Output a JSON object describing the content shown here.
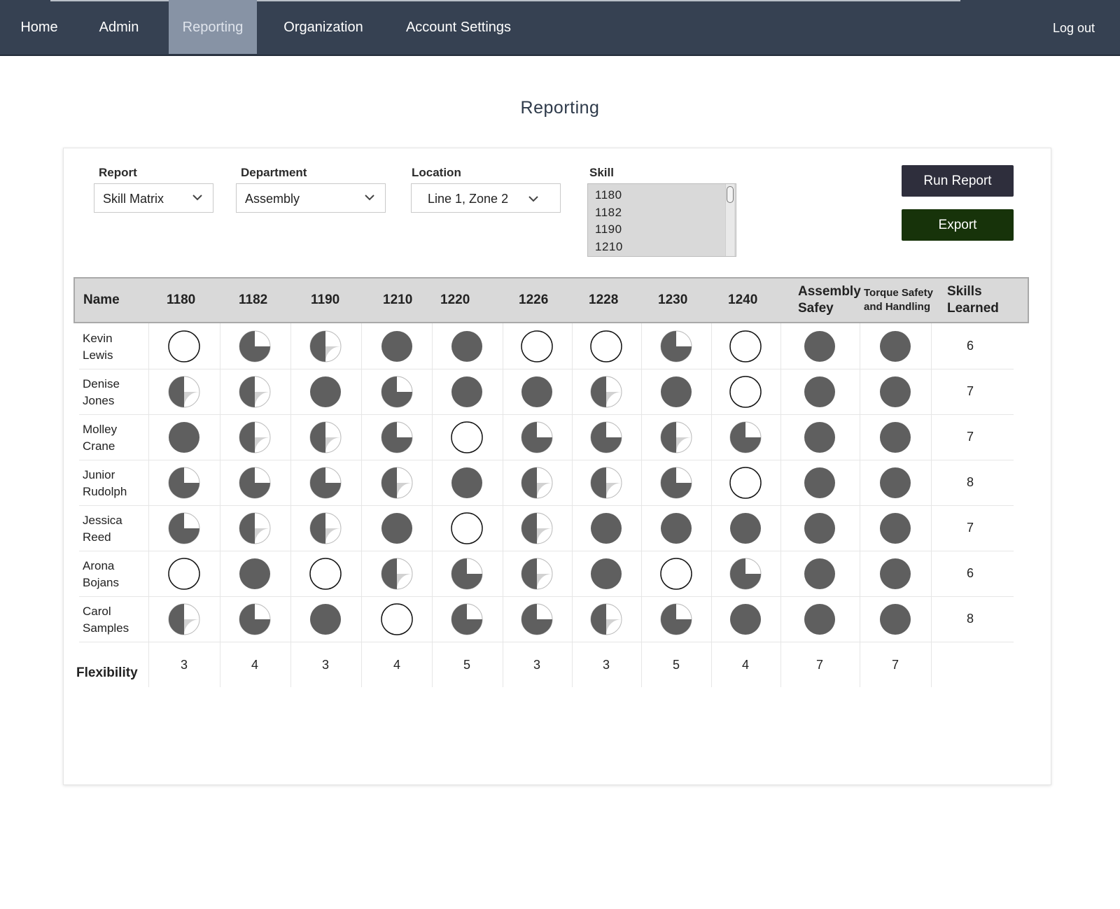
{
  "nav": {
    "items": [
      {
        "id": "home",
        "label": "Home"
      },
      {
        "id": "admin",
        "label": "Admin"
      },
      {
        "id": "reporting",
        "label": "Reporting"
      },
      {
        "id": "organization",
        "label": "Organization"
      },
      {
        "id": "account-settings",
        "label": "Account Settings"
      }
    ],
    "active": "Reporting",
    "logout": "Log out"
  },
  "page": {
    "title": "Reporting"
  },
  "filters": {
    "report": {
      "label": "Report",
      "value": "Skill Matrix"
    },
    "department": {
      "label": "Department",
      "value": "Assembly"
    },
    "location": {
      "label": "Location",
      "value": "Line 1, Zone 2"
    },
    "skill": {
      "label": "Skill",
      "options": [
        "1180",
        "1182",
        "1190",
        "1210"
      ]
    }
  },
  "buttons": {
    "run_report": "Run Report",
    "export": "Export"
  },
  "table": {
    "name_header": "Name",
    "skill_headers": [
      "1180",
      "1182",
      "1190",
      "1210",
      "1220",
      "1226",
      "1228",
      "1230",
      "1240",
      "Assembly Safey",
      "Torque Safety and Handling"
    ],
    "skills_learned_header": "Skills Learned",
    "rows": [
      {
        "name": "Kevin Lewis",
        "levels": [
          0,
          3,
          2,
          4,
          4,
          0,
          0,
          3,
          0,
          4,
          4
        ],
        "skills_learned": "6"
      },
      {
        "name": "Denise Jones",
        "levels": [
          2,
          2,
          4,
          3,
          4,
          4,
          2,
          4,
          0,
          4,
          4
        ],
        "skills_learned": "7"
      },
      {
        "name": "Molley Crane",
        "levels": [
          4,
          2,
          2,
          3,
          0,
          3,
          3,
          2,
          3,
          4,
          4
        ],
        "skills_learned": "7"
      },
      {
        "name": "Junior Rudolph",
        "levels": [
          3,
          3,
          3,
          2,
          4,
          2,
          2,
          3,
          0,
          4,
          4
        ],
        "skills_learned": "8"
      },
      {
        "name": "Jessica Reed",
        "levels": [
          3,
          2,
          2,
          4,
          0,
          2,
          4,
          4,
          4,
          4,
          4
        ],
        "skills_learned": "7"
      },
      {
        "name": "Arona Bojans",
        "levels": [
          0,
          4,
          0,
          2,
          3,
          2,
          4,
          0,
          3,
          4,
          4
        ],
        "skills_learned": "6"
      },
      {
        "name": "Carol Samples",
        "levels": [
          2,
          3,
          4,
          0,
          3,
          3,
          2,
          3,
          4,
          4,
          4
        ],
        "skills_learned": "8"
      }
    ],
    "flexibility_label": "Flexibility",
    "flexibility": [
      "3",
      "4",
      "3",
      "4",
      "5",
      "3",
      "3",
      "5",
      "4",
      "7",
      "7"
    ]
  },
  "legend_levels": {
    "0": "empty",
    "2": "half",
    "3": "three-quarter",
    "4": "full"
  },
  "colors": {
    "nav_bg": "#364152",
    "nav_active": "#8793a5",
    "filled": "#5f5f5f",
    "partial": "#d2d2d2",
    "run_btn": "#2e2e3c",
    "export_btn": "#17330a"
  }
}
